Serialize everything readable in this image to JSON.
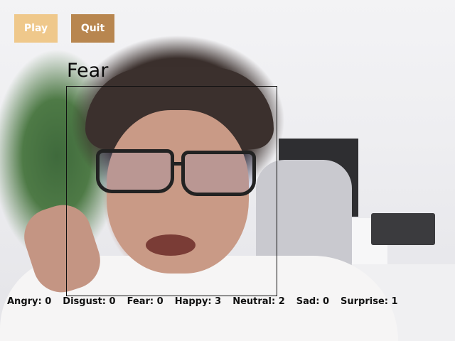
{
  "buttons": {
    "play_label": "Play",
    "quit_label": "Quit"
  },
  "detection": {
    "emotion": "Fear"
  },
  "counts": [
    {
      "label": "Angry: 0"
    },
    {
      "label": "Disgust: 0"
    },
    {
      "label": "Fear: 0"
    },
    {
      "label": "Happy: 3"
    },
    {
      "label": "Neutral: 2"
    },
    {
      "label": "Sad: 0"
    },
    {
      "label": "Surprise: 1"
    }
  ],
  "colors": {
    "play_button": "#efc88b",
    "quit_button": "#b8864f",
    "text": "#111111"
  }
}
